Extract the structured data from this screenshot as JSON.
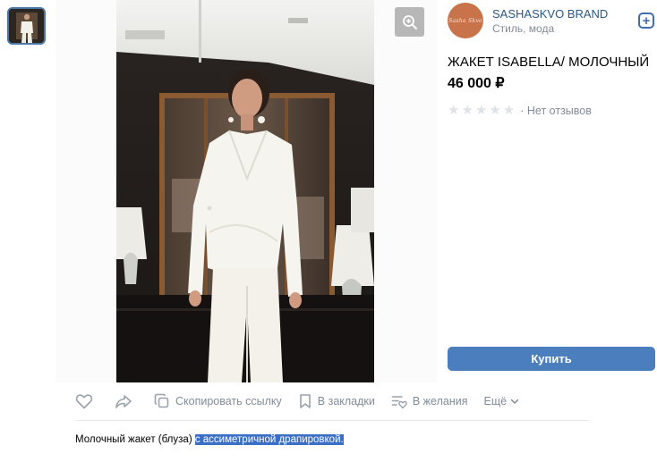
{
  "shop": {
    "avatar_text": "Sasha Skvo",
    "name": "SASHASKVO BRAND",
    "category": "Стиль, мода"
  },
  "product": {
    "title": "ЖАКЕТ ISABELLA/ МОЛОЧНЫЙ",
    "price": "46 000 ₽",
    "rating_stars": 0,
    "rating_max": 5,
    "reviews": "· Нет отзывов",
    "buy_label": "Купить",
    "description_plain": "Молочный жакет (блуза) ",
    "description_selected": "с ассиметричной драпировкой."
  },
  "actions": {
    "copy_link": "Скопировать ссылку",
    "bookmarks": "В закладки",
    "wishlist": "В желания",
    "more": "Ещё"
  },
  "colors": {
    "link": "#2a5885",
    "muted": "#818c99",
    "button": "#4a7ebd",
    "selection": "#3b6fc7"
  }
}
